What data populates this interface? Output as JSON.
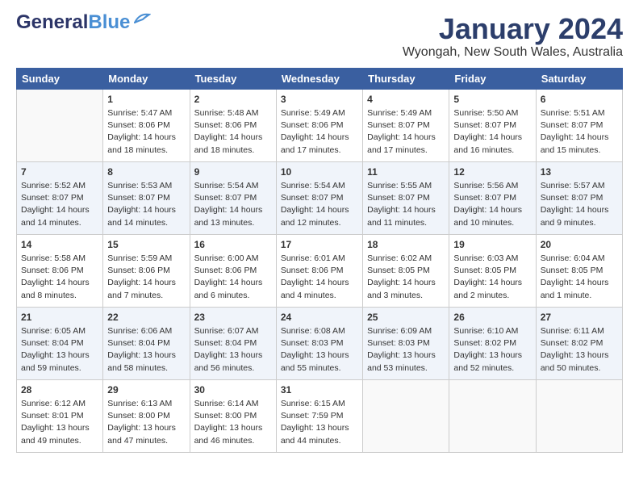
{
  "header": {
    "logo_general": "General",
    "logo_blue": "Blue",
    "title": "January 2024",
    "subtitle": "Wyongah, New South Wales, Australia"
  },
  "weekdays": [
    "Sunday",
    "Monday",
    "Tuesday",
    "Wednesday",
    "Thursday",
    "Friday",
    "Saturday"
  ],
  "weeks": [
    [
      {
        "day": "",
        "lines": []
      },
      {
        "day": "1",
        "lines": [
          "Sunrise: 5:47 AM",
          "Sunset: 8:06 PM",
          "Daylight: 14 hours",
          "and 18 minutes."
        ]
      },
      {
        "day": "2",
        "lines": [
          "Sunrise: 5:48 AM",
          "Sunset: 8:06 PM",
          "Daylight: 14 hours",
          "and 18 minutes."
        ]
      },
      {
        "day": "3",
        "lines": [
          "Sunrise: 5:49 AM",
          "Sunset: 8:06 PM",
          "Daylight: 14 hours",
          "and 17 minutes."
        ]
      },
      {
        "day": "4",
        "lines": [
          "Sunrise: 5:49 AM",
          "Sunset: 8:07 PM",
          "Daylight: 14 hours",
          "and 17 minutes."
        ]
      },
      {
        "day": "5",
        "lines": [
          "Sunrise: 5:50 AM",
          "Sunset: 8:07 PM",
          "Daylight: 14 hours",
          "and 16 minutes."
        ]
      },
      {
        "day": "6",
        "lines": [
          "Sunrise: 5:51 AM",
          "Sunset: 8:07 PM",
          "Daylight: 14 hours",
          "and 15 minutes."
        ]
      }
    ],
    [
      {
        "day": "7",
        "lines": [
          "Sunrise: 5:52 AM",
          "Sunset: 8:07 PM",
          "Daylight: 14 hours",
          "and 14 minutes."
        ]
      },
      {
        "day": "8",
        "lines": [
          "Sunrise: 5:53 AM",
          "Sunset: 8:07 PM",
          "Daylight: 14 hours",
          "and 14 minutes."
        ]
      },
      {
        "day": "9",
        "lines": [
          "Sunrise: 5:54 AM",
          "Sunset: 8:07 PM",
          "Daylight: 14 hours",
          "and 13 minutes."
        ]
      },
      {
        "day": "10",
        "lines": [
          "Sunrise: 5:54 AM",
          "Sunset: 8:07 PM",
          "Daylight: 14 hours",
          "and 12 minutes."
        ]
      },
      {
        "day": "11",
        "lines": [
          "Sunrise: 5:55 AM",
          "Sunset: 8:07 PM",
          "Daylight: 14 hours",
          "and 11 minutes."
        ]
      },
      {
        "day": "12",
        "lines": [
          "Sunrise: 5:56 AM",
          "Sunset: 8:07 PM",
          "Daylight: 14 hours",
          "and 10 minutes."
        ]
      },
      {
        "day": "13",
        "lines": [
          "Sunrise: 5:57 AM",
          "Sunset: 8:07 PM",
          "Daylight: 14 hours",
          "and 9 minutes."
        ]
      }
    ],
    [
      {
        "day": "14",
        "lines": [
          "Sunrise: 5:58 AM",
          "Sunset: 8:06 PM",
          "Daylight: 14 hours",
          "and 8 minutes."
        ]
      },
      {
        "day": "15",
        "lines": [
          "Sunrise: 5:59 AM",
          "Sunset: 8:06 PM",
          "Daylight: 14 hours",
          "and 7 minutes."
        ]
      },
      {
        "day": "16",
        "lines": [
          "Sunrise: 6:00 AM",
          "Sunset: 8:06 PM",
          "Daylight: 14 hours",
          "and 6 minutes."
        ]
      },
      {
        "day": "17",
        "lines": [
          "Sunrise: 6:01 AM",
          "Sunset: 8:06 PM",
          "Daylight: 14 hours",
          "and 4 minutes."
        ]
      },
      {
        "day": "18",
        "lines": [
          "Sunrise: 6:02 AM",
          "Sunset: 8:05 PM",
          "Daylight: 14 hours",
          "and 3 minutes."
        ]
      },
      {
        "day": "19",
        "lines": [
          "Sunrise: 6:03 AM",
          "Sunset: 8:05 PM",
          "Daylight: 14 hours",
          "and 2 minutes."
        ]
      },
      {
        "day": "20",
        "lines": [
          "Sunrise: 6:04 AM",
          "Sunset: 8:05 PM",
          "Daylight: 14 hours",
          "and 1 minute."
        ]
      }
    ],
    [
      {
        "day": "21",
        "lines": [
          "Sunrise: 6:05 AM",
          "Sunset: 8:04 PM",
          "Daylight: 13 hours",
          "and 59 minutes."
        ]
      },
      {
        "day": "22",
        "lines": [
          "Sunrise: 6:06 AM",
          "Sunset: 8:04 PM",
          "Daylight: 13 hours",
          "and 58 minutes."
        ]
      },
      {
        "day": "23",
        "lines": [
          "Sunrise: 6:07 AM",
          "Sunset: 8:04 PM",
          "Daylight: 13 hours",
          "and 56 minutes."
        ]
      },
      {
        "day": "24",
        "lines": [
          "Sunrise: 6:08 AM",
          "Sunset: 8:03 PM",
          "Daylight: 13 hours",
          "and 55 minutes."
        ]
      },
      {
        "day": "25",
        "lines": [
          "Sunrise: 6:09 AM",
          "Sunset: 8:03 PM",
          "Daylight: 13 hours",
          "and 53 minutes."
        ]
      },
      {
        "day": "26",
        "lines": [
          "Sunrise: 6:10 AM",
          "Sunset: 8:02 PM",
          "Daylight: 13 hours",
          "and 52 minutes."
        ]
      },
      {
        "day": "27",
        "lines": [
          "Sunrise: 6:11 AM",
          "Sunset: 8:02 PM",
          "Daylight: 13 hours",
          "and 50 minutes."
        ]
      }
    ],
    [
      {
        "day": "28",
        "lines": [
          "Sunrise: 6:12 AM",
          "Sunset: 8:01 PM",
          "Daylight: 13 hours",
          "and 49 minutes."
        ]
      },
      {
        "day": "29",
        "lines": [
          "Sunrise: 6:13 AM",
          "Sunset: 8:00 PM",
          "Daylight: 13 hours",
          "and 47 minutes."
        ]
      },
      {
        "day": "30",
        "lines": [
          "Sunrise: 6:14 AM",
          "Sunset: 8:00 PM",
          "Daylight: 13 hours",
          "and 46 minutes."
        ]
      },
      {
        "day": "31",
        "lines": [
          "Sunrise: 6:15 AM",
          "Sunset: 7:59 PM",
          "Daylight: 13 hours",
          "and 44 minutes."
        ]
      },
      {
        "day": "",
        "lines": []
      },
      {
        "day": "",
        "lines": []
      },
      {
        "day": "",
        "lines": []
      }
    ]
  ]
}
